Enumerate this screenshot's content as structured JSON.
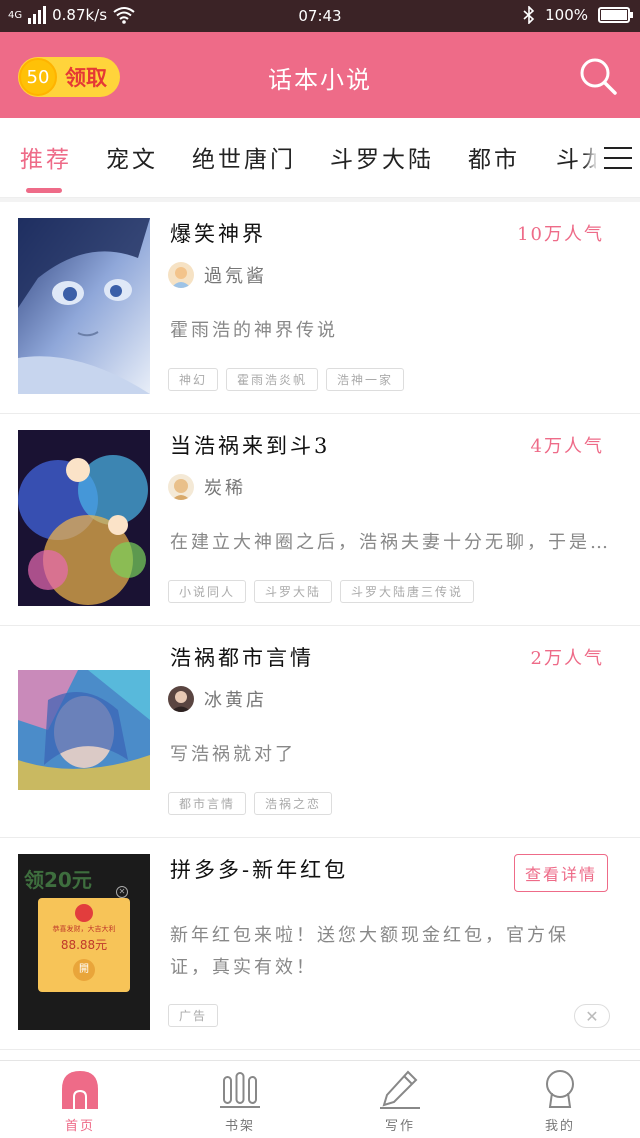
{
  "statusbar": {
    "network": "4G",
    "speed": "0.87k/s",
    "time": "07:43",
    "battery": "100%"
  },
  "header": {
    "claim_amount": "50",
    "claim_label": "领取",
    "title": "话本小说"
  },
  "tabs": [
    "推荐",
    "宠文",
    "绝世唐门",
    "斗罗大陆",
    "都市",
    "斗龙"
  ],
  "books": [
    {
      "title": "爆笑神界",
      "popularity": "10万人气",
      "author": "過氖酱",
      "desc": "霍雨浩的神界传说",
      "tags": [
        "神幻",
        "霍雨浩炎帆",
        "浩神一家"
      ]
    },
    {
      "title": "当浩祸来到斗3",
      "popularity": "4万人气",
      "author": "炭稀",
      "desc": "在建立大神圈之后，浩祸夫妻十分无聊，于是…",
      "tags": [
        "小说同人",
        "斗罗大陆",
        "斗罗大陆唐三传说"
      ]
    },
    {
      "title": "浩祸都市言情",
      "popularity": "2万人气",
      "author": "冰黄店",
      "desc": "写浩祸就对了",
      "tags": [
        "都市言情",
        "浩祸之恋"
      ]
    }
  ],
  "ad": {
    "title": "拼多多-新年红包",
    "detail_label": "查看详情",
    "desc": "新年红包来啦！送您大额现金红包，官方保证，真实有效！",
    "tag": "广告",
    "close_glyph": "✕",
    "thumb_text": "领20元",
    "thumb_popup_title": "恭喜发财，大吉大利",
    "thumb_amount": "88.88元",
    "thumb_open": "開"
  },
  "bottom_nav": [
    {
      "label": "首页",
      "icon": "home-icon",
      "active": true
    },
    {
      "label": "书架",
      "icon": "bookshelf-icon",
      "active": false
    },
    {
      "label": "写作",
      "icon": "pen-icon",
      "active": false
    },
    {
      "label": "我的",
      "icon": "profile-icon",
      "active": false
    }
  ],
  "colors": {
    "accent": "#ee6b88",
    "statusbar": "#3b2326",
    "claim_bg": "#ffd43b"
  }
}
